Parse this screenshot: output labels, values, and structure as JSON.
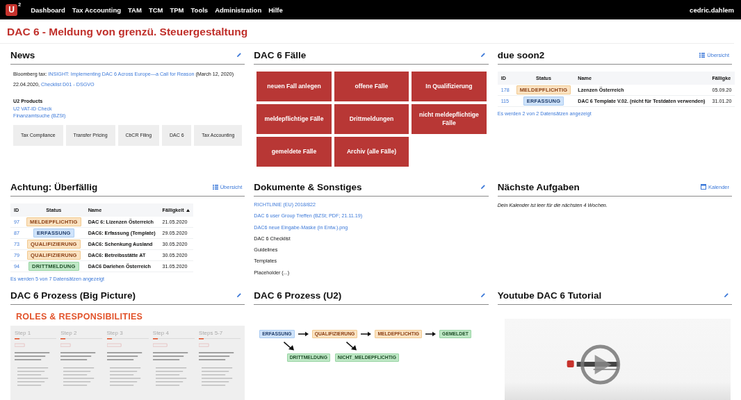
{
  "nav": {
    "logo": {
      "letter": "U",
      "sup": "2"
    },
    "items": [
      {
        "label": "Dashboard"
      },
      {
        "label": "Tax Accounting"
      },
      {
        "label": "TAM"
      },
      {
        "label": "TCM"
      },
      {
        "label": "TPM"
      },
      {
        "label": "Tools"
      },
      {
        "label": "Administration"
      },
      {
        "label": "Hilfe"
      }
    ],
    "user": "cedric.dahlem"
  },
  "page_title": "DAC 6 - Meldung von grenzü. Steuergestaltung",
  "widgets": [
    {
      "title": "News",
      "action": {
        "kind": "edit"
      },
      "content": {
        "kind": "news",
        "paragraphs": [
          {
            "parts": [
              {
                "text": "Bloomberg tax: "
              },
              {
                "link": "INSIGHT: Implementing DAC 6 Across Europe—a Call for Reason"
              },
              {
                "text": " (March 12, 2020)"
              }
            ]
          },
          {
            "parts": [
              {
                "text": "22.04.2020, "
              },
              {
                "link": "Checklist D01 - DSGVO"
              }
            ]
          }
        ],
        "products_heading": "U2 Products",
        "product_links": [
          "U2 VAT-ID Check",
          "Finanzamtsuche (BZSt)"
        ],
        "buttons": [
          "Tax Compliance",
          "Transfer Pricing",
          "CbCR Filing",
          "DAC 6",
          "Tax Accounting"
        ]
      }
    },
    {
      "title": "DAC 6 Fälle",
      "action": {
        "kind": "edit"
      },
      "content": {
        "kind": "tiles",
        "tiles": [
          "neuen Fall anlegen",
          "offene Fälle",
          "In Qualifizierung",
          "meldepflichtige Fälle",
          "Drittmeldungen",
          "nicht meldepflichtige Fälle",
          "gemeldete Fälle",
          "Archiv (alle Fälle)"
        ]
      }
    },
    {
      "title": "due soon2",
      "action": {
        "kind": "list",
        "label": "Übersicht"
      },
      "content": {
        "kind": "table",
        "columns": [
          {
            "label": "ID",
            "sorted": false
          },
          {
            "label": "Status",
            "sorted": false
          },
          {
            "label": "Name",
            "sorted": false
          },
          {
            "label": "Fälligke",
            "sorted": false
          }
        ],
        "rows": [
          {
            "id": "178",
            "status": {
              "label": "MELDEPFLICHTIG",
              "kind": "warning"
            },
            "name": "Lzenzen Österreich",
            "due": "05.09.20"
          },
          {
            "id": "115",
            "status": {
              "label": "ERFASSUNG",
              "kind": "info"
            },
            "name": "DAC 6 Template V.02. (nicht für Testdaten verwenden)",
            "due": "31.01.20"
          }
        ],
        "footer": "Es werden 2 von 2 Datensätzen angezeigt"
      }
    },
    {
      "title": "Achtung: Überfällig",
      "action": {
        "kind": "list",
        "label": "Übersicht"
      },
      "content": {
        "kind": "table",
        "columns": [
          {
            "label": "ID",
            "sorted": false
          },
          {
            "label": "Status",
            "sorted": false
          },
          {
            "label": "Name",
            "sorted": false
          },
          {
            "label": "Fälligkeit",
            "sorted": true
          }
        ],
        "rows": [
          {
            "id": "97",
            "status": {
              "label": "MELDEPFLICHTIG",
              "kind": "warning"
            },
            "name": "DAC 6: Lizenzen Österreich",
            "due": "21.05.2020"
          },
          {
            "id": "87",
            "status": {
              "label": "ERFASSUNG",
              "kind": "info"
            },
            "name": "DAC6: Erfassung (Template)",
            "due": "29.05.2020"
          },
          {
            "id": "73",
            "status": {
              "label": "QUALIFIZIERUNG",
              "kind": "warning"
            },
            "name": "DAC6: Schenkung Ausland",
            "due": "30.05.2020"
          },
          {
            "id": "79",
            "status": {
              "label": "QUALIFIZIERUNG",
              "kind": "warning"
            },
            "name": "DAC6: Betreibsstätte AT",
            "due": "30.05.2020"
          },
          {
            "id": "94",
            "status": {
              "label": "DRITTMELDUNG",
              "kind": "success"
            },
            "name": "DAC6 Darlehen Österreich",
            "due": "31.05.2020"
          }
        ],
        "footer": "Es werden 5 von 7 Datensätzen angezeigt"
      }
    },
    {
      "title": "Dokumente & Sonstiges",
      "action": {
        "kind": "edit"
      },
      "content": {
        "kind": "links",
        "items": [
          {
            "label": "RICHTLINIE (EU) 2018/822",
            "link": true
          },
          {
            "label": "DAC 6 user Group Treffen (BZSt; PDF; 21.11.19)",
            "link": true
          },
          {
            "label": "DAC6 neue Eingabe-Maske (in Entw.).png",
            "link": true
          },
          {
            "label": "DAC 6 Checklist",
            "link": false
          },
          {
            "label": "Guidelines",
            "link": false
          },
          {
            "label": "Templates",
            "link": false
          },
          {
            "label": "Placeholder (...)",
            "link": false
          }
        ]
      }
    },
    {
      "title": "Nächste Aufgaben",
      "action": {
        "kind": "calendar",
        "label": "Kalender"
      },
      "content": {
        "kind": "empty",
        "text": "Dein Kalender ist leer für die nächsten 4 Wochen."
      }
    },
    {
      "title": "DAC 6 Prozess (Big Picture)",
      "action": {
        "kind": "edit"
      },
      "content": {
        "kind": "roles",
        "heading": "ROLES & RESPONSIBILITIES",
        "steps": [
          "Step 1",
          "Step 2",
          "Step 3",
          "Step 4",
          "Steps 5-7"
        ]
      }
    },
    {
      "title": "DAC 6 Prozess (U2)",
      "action": {
        "kind": "edit"
      },
      "content": {
        "kind": "process",
        "main": [
          {
            "label": "ERFASSUNG",
            "kind": "info"
          },
          {
            "label": "QUALIFIZIERUNG",
            "kind": "warning"
          },
          {
            "label": "MELDEPFLICHTIG",
            "kind": "warning"
          },
          {
            "label": "GEMELDET",
            "kind": "success"
          }
        ],
        "branches": [
          {
            "label": "DRITTMELDUNG",
            "kind": "success"
          },
          {
            "label": "NICHT_MELDEPFLICHTIG",
            "kind": "success"
          }
        ]
      }
    },
    {
      "title": "Youtube DAC 6 Tutorial",
      "action": {
        "kind": "edit"
      },
      "content": {
        "kind": "video"
      }
    }
  ]
}
